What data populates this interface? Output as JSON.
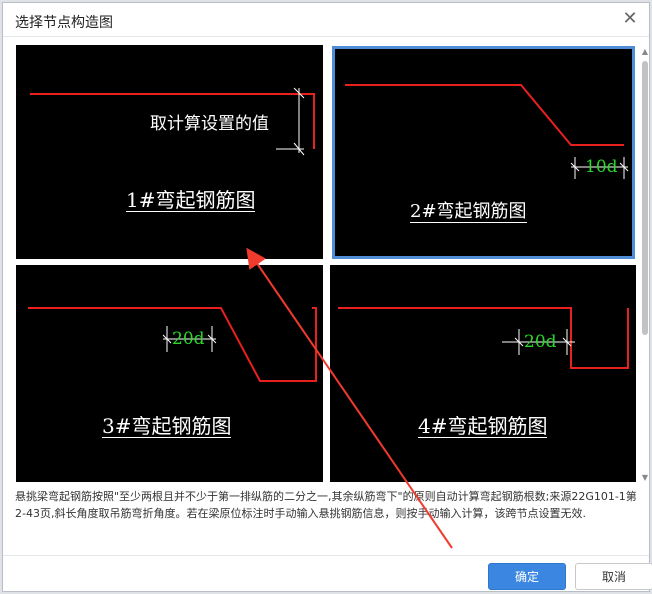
{
  "dialog": {
    "title": "选择节点构造图",
    "close_glyph": "✕"
  },
  "panels": [
    {
      "caption": "1#弯起钢筋图",
      "note": "取计算设置的值"
    },
    {
      "caption": "2#弯起钢筋图",
      "dimension": "10d"
    },
    {
      "caption": "3#弯起钢筋图",
      "dimension": "20d"
    },
    {
      "caption": "4#弯起钢筋图",
      "dimension": "20d"
    }
  ],
  "description": "悬挑梁弯起钢筋按照\"至少两根且并不少于第一排纵筋的二分之一,其余纵筋弯下\"的原则自动计算弯起钢筋根数;来源22G101-1第2-43页,斜长角度取吊筋弯折角度。若在梁原位标注时手动输入悬挑钢筋信息，则按手动输入计算，该跨节点设置无效.",
  "buttons": {
    "ok_label": "确定",
    "cancel_label": "取消"
  },
  "colors": {
    "accent": "#3b86e0",
    "selected_border": "#4f8dd6",
    "rebar_line": "#e8201e",
    "dimension_text": "#2bd82b",
    "annotation_arrow": "#f03a2e"
  }
}
